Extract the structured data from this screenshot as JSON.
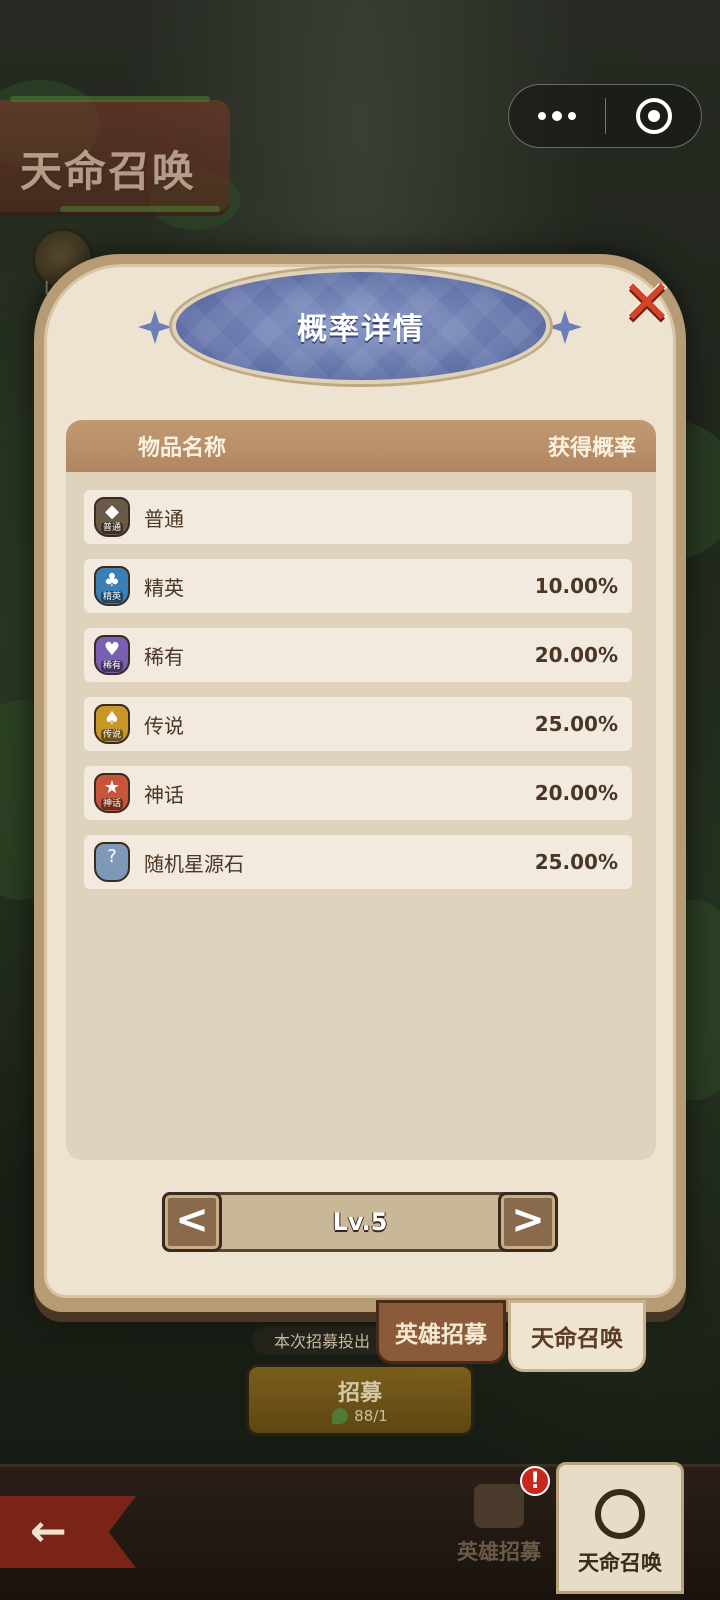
{
  "background": {
    "title": "天命召唤",
    "level_text": "Lv.5"
  },
  "capsule": {
    "more_icon": "ellipsis-icon",
    "close_icon": "target-close-icon"
  },
  "modal": {
    "title": "概率详情",
    "close_icon": "close-x-icon",
    "table": {
      "col_name": "物品名称",
      "col_rate": "获得概率",
      "rows": [
        {
          "tag": "普通",
          "name": "普通",
          "rate": "",
          "color": "#6b5a48",
          "symbol": "◆"
        },
        {
          "tag": "精英",
          "name": "精英",
          "rate": "10.00%",
          "color": "#3c7fb4",
          "symbol": "♣"
        },
        {
          "tag": "稀有",
          "name": "稀有",
          "rate": "20.00%",
          "color": "#7a5fb5",
          "symbol": "♥"
        },
        {
          "tag": "传说",
          "name": "传说",
          "rate": "25.00%",
          "color": "#c9962a",
          "symbol": "♠"
        },
        {
          "tag": "神话",
          "name": "神话",
          "rate": "20.00%",
          "color": "#c7553a",
          "symbol": "★"
        },
        {
          "tag": "",
          "name": "随机星源石",
          "rate": "25.00%",
          "color": "#7e98b8",
          "symbol": "?"
        }
      ]
    },
    "level": {
      "label": "Lv.5",
      "prev": "<",
      "next": ">"
    }
  },
  "tabs": {
    "hero": "英雄招募",
    "fate": "天命召唤"
  },
  "recruit": {
    "info": "本次招募投出",
    "button": "招募",
    "cost": "88/1"
  },
  "nav": {
    "back_symbol": "←",
    "hero_label": "英雄招募",
    "fate_label": "天命召唤",
    "alert": "!"
  }
}
